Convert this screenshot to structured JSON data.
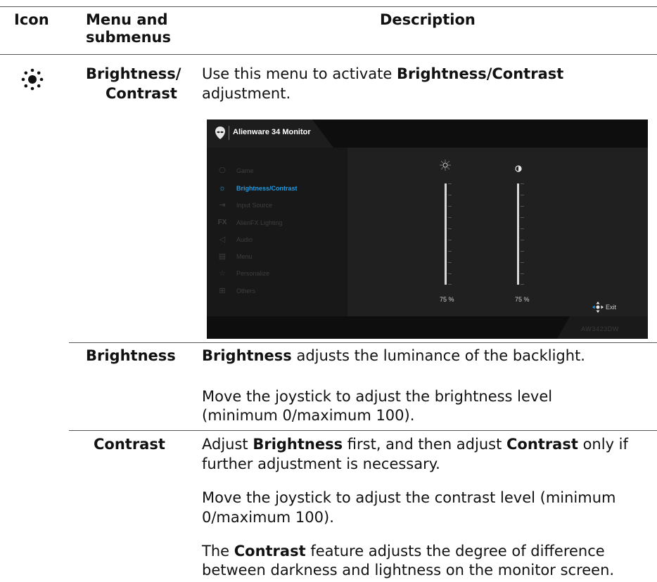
{
  "table": {
    "headers": {
      "icon": "Icon",
      "menu": "Menu and submenus",
      "description": "Description"
    },
    "section": {
      "icon_name": "brightness-icon",
      "menu_line1": "Brightness/",
      "menu_line2": "Contrast",
      "desc_line1_pre": "Use this menu to activate ",
      "desc_line1_bold": "Brightness/Contrast",
      "desc_line2": "adjustment."
    },
    "rows": [
      {
        "name": "Brightness",
        "p1_bold": "Brightness",
        "p1_rest": " adjusts the luminance of the backlight.",
        "p2_line1": "Move the joystick to adjust the brightness level",
        "p2_line2": "(minimum 0/maximum 100)."
      },
      {
        "name": "Contrast",
        "p1_l1_pre": "Adjust ",
        "p1_l1_b1": "Brightness",
        "p1_l1_mid": " first, and then adjust ",
        "p1_l1_b2": "Contrast",
        "p1_l1_post": " only if",
        "p1_l2": "further adjustment is necessary.",
        "p2_line1": "Move the joystick to adjust the contrast level (minimum",
        "p2_line2": "0/maximum 100).",
        "p3_pre": "The ",
        "p3_bold": "Contrast",
        "p3_l1_post": " feature adjusts the degree of difference",
        "p3_line2": "between darkness and lightness on the monitor screen."
      }
    ]
  },
  "osd": {
    "title": "Alienware 34 Monitor",
    "model": "AW3423DW",
    "menu_items": [
      {
        "label": "Game",
        "icon": "gamepad-icon",
        "active": false
      },
      {
        "label": "Brightness/Contrast",
        "icon": "brightness-icon",
        "active": true
      },
      {
        "label": "Input Source",
        "icon": "input-source-icon",
        "active": false
      },
      {
        "label": "AlienFX Lighting",
        "icon": "fx-icon",
        "active": false
      },
      {
        "label": "Audio",
        "icon": "speaker-icon",
        "active": false
      },
      {
        "label": "Menu",
        "icon": "menu-icon",
        "active": false
      },
      {
        "label": "Personalize",
        "icon": "star-icon",
        "active": false
      },
      {
        "label": "Others",
        "icon": "others-icon",
        "active": false
      }
    ],
    "brightness_value": "75 %",
    "contrast_value": "75 %",
    "brightness_level": 75,
    "contrast_level": 75,
    "exit_label": "Exit",
    "accent_color": "#1f9ce6"
  }
}
